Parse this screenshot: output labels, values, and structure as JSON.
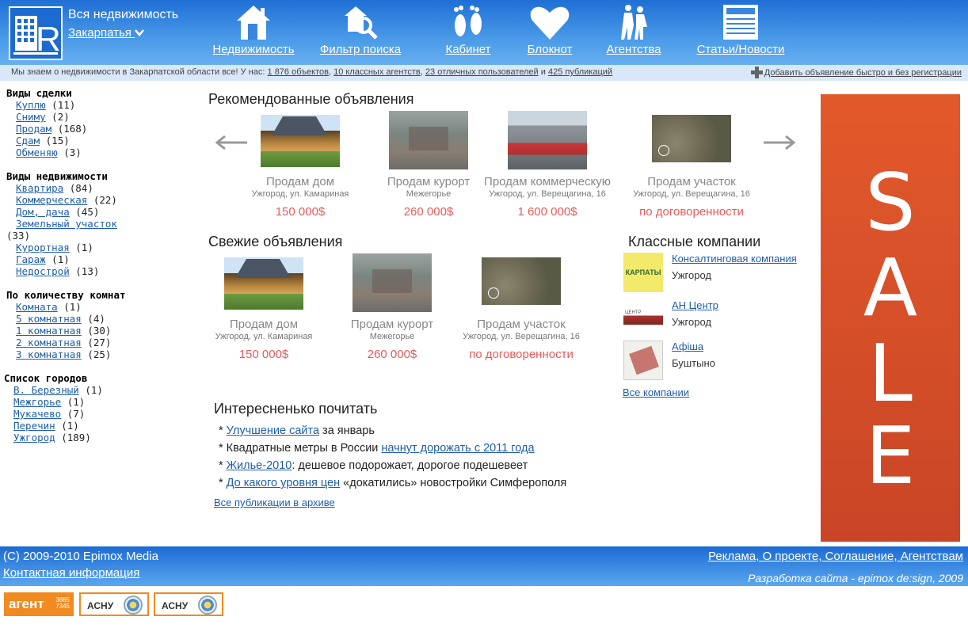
{
  "header": {
    "site_title": "Вся недвижимость",
    "region": "Закарпатья",
    "nav": [
      {
        "label": "Недвижимость",
        "icon": "house-icon"
      },
      {
        "label": "Фильтр поиска",
        "icon": "search-filter-icon"
      },
      {
        "label": "Кабинет",
        "icon": "footprints-icon"
      },
      {
        "label": "Блокнот",
        "icon": "heart-icon"
      },
      {
        "label": "Агентства",
        "icon": "people-icon"
      },
      {
        "label": "Статьи/Новости",
        "icon": "newspaper-icon"
      }
    ]
  },
  "infobar": {
    "prefix": "Мы знаем о недвижимости в Закарпатской области все! У нас:",
    "objects": "1 876 объектов",
    "agents": "10 классных агентств",
    "users": "23 отличных пользователей",
    "and": "и",
    "pubs": "425 публикаций",
    "add_ad": "Добавить объявление быстро и без регистрации"
  },
  "sidebar": {
    "deal_title": "Виды сделки",
    "deal": [
      {
        "label": "Куплю",
        "count": "(11)"
      },
      {
        "label": "Сниму",
        "count": "(2)"
      },
      {
        "label": "Продам",
        "count": "(168)"
      },
      {
        "label": "Сдам",
        "count": "(15)"
      },
      {
        "label": "Обменяю",
        "count": "(3)"
      }
    ],
    "type_title": "Виды недвижимости",
    "types": [
      {
        "label": "Квартира",
        "count": "(84)"
      },
      {
        "label": "Коммерческая",
        "count": "(22)"
      },
      {
        "label": "Дом, дача",
        "count": "(45)"
      },
      {
        "label": "Земельный участок",
        "count": "(33)"
      },
      {
        "label": "Курортная",
        "count": "(1)"
      },
      {
        "label": "Гараж",
        "count": "(1)"
      },
      {
        "label": "Недострой",
        "count": "(13)"
      }
    ],
    "rooms_title": "По количеству комнат",
    "rooms": [
      {
        "label": "Комната",
        "count": "(1)"
      },
      {
        "label": "5 комнатная",
        "count": "(4)"
      },
      {
        "label": "1 комнатная",
        "count": "(30)"
      },
      {
        "label": "2 комнатная",
        "count": "(27)"
      },
      {
        "label": "3 комнатная",
        "count": "(25)"
      }
    ],
    "cities_title": "Список городов",
    "cities": [
      {
        "label": "В. Березный",
        "count": "(1)"
      },
      {
        "label": "Межгорье",
        "count": "(1)"
      },
      {
        "label": "Мукачево",
        "count": "(7)"
      },
      {
        "label": "Перечин",
        "count": "(1)"
      },
      {
        "label": "Ужгород",
        "count": "(189)"
      }
    ]
  },
  "recommended": {
    "title": "Рекомендованные объявления",
    "items": [
      {
        "title": "Продам дом",
        "address": "Ужгород, ул. Камариная",
        "price": "150 000$",
        "thumb": "house"
      },
      {
        "title": "Продам курорт",
        "address": "Межегорье",
        "price": "260 000$",
        "thumb": "resort"
      },
      {
        "title": "Продам коммерческую",
        "address": "Ужгород, ул. Верещагина, 16",
        "price": "1 600 000$",
        "thumb": "commercial"
      },
      {
        "title": "Продам участок",
        "address": "Ужгород, ул. Верещагина, 16",
        "price": "по договоренности",
        "thumb": "land"
      }
    ]
  },
  "fresh": {
    "title": "Свежие объявления",
    "items": [
      {
        "title": "Продам дом",
        "address": "Ужгород, ул. Камариная",
        "price": "150 000$",
        "thumb": "house"
      },
      {
        "title": "Продам курорт",
        "address": "Межегорье",
        "price": "260 000$",
        "thumb": "resort"
      },
      {
        "title": "Продам участок",
        "address": "Ужгород, ул. Верещагина, 16",
        "price": "по договоренности",
        "thumb": "land"
      }
    ]
  },
  "companies": {
    "title": "Классные компании",
    "items": [
      {
        "name": "Консалтинговая компания",
        "city": "Ужгород",
        "logo_text": "КАРПАТЫ"
      },
      {
        "name": "АН Центр",
        "city": "Ужгород",
        "logo_text": "ЦЕНТР"
      },
      {
        "name": "Афіша",
        "city": "Буштыно",
        "logo_text": ""
      }
    ],
    "all": "Все компании"
  },
  "reading": {
    "title": "Интересненько почитать",
    "items": [
      {
        "pre": "* ",
        "link": "Улучшение сайта",
        "post": " за январь"
      },
      {
        "pre": "* Квадратные метры в России ",
        "link": "начнут дорожать с 2011 года",
        "post": ""
      },
      {
        "pre": "* ",
        "link": "Жилье-2010",
        "post": ": дешевое подорожает, дорогое подешевеет"
      },
      {
        "pre": "* ",
        "link": "До какого уровня цен",
        "post": " «докатились» новостройки Симферополя"
      }
    ],
    "archive": "Все публикации в архиве"
  },
  "sale": {
    "letters": [
      "S",
      "A",
      "L",
      "E"
    ]
  },
  "footer": {
    "copyright": "(C) 2009-2010 Epimox Media",
    "contact": "Контактная информация",
    "links": "Реклама, О проекте, Соглашение, Агентствам",
    "dev": "Разработка сайта - epimox de:sign, 2009"
  },
  "badges": {
    "agent": "агент",
    "agent_nums_1": "3885",
    "agent_nums_2": "7345",
    "asnu": "АСНУ"
  },
  "colors": {
    "header_blue": "#1f6fd6",
    "sale_orange": "#e2592b",
    "price_red": "#e85a5a",
    "link_blue": "#1f5ea8"
  }
}
